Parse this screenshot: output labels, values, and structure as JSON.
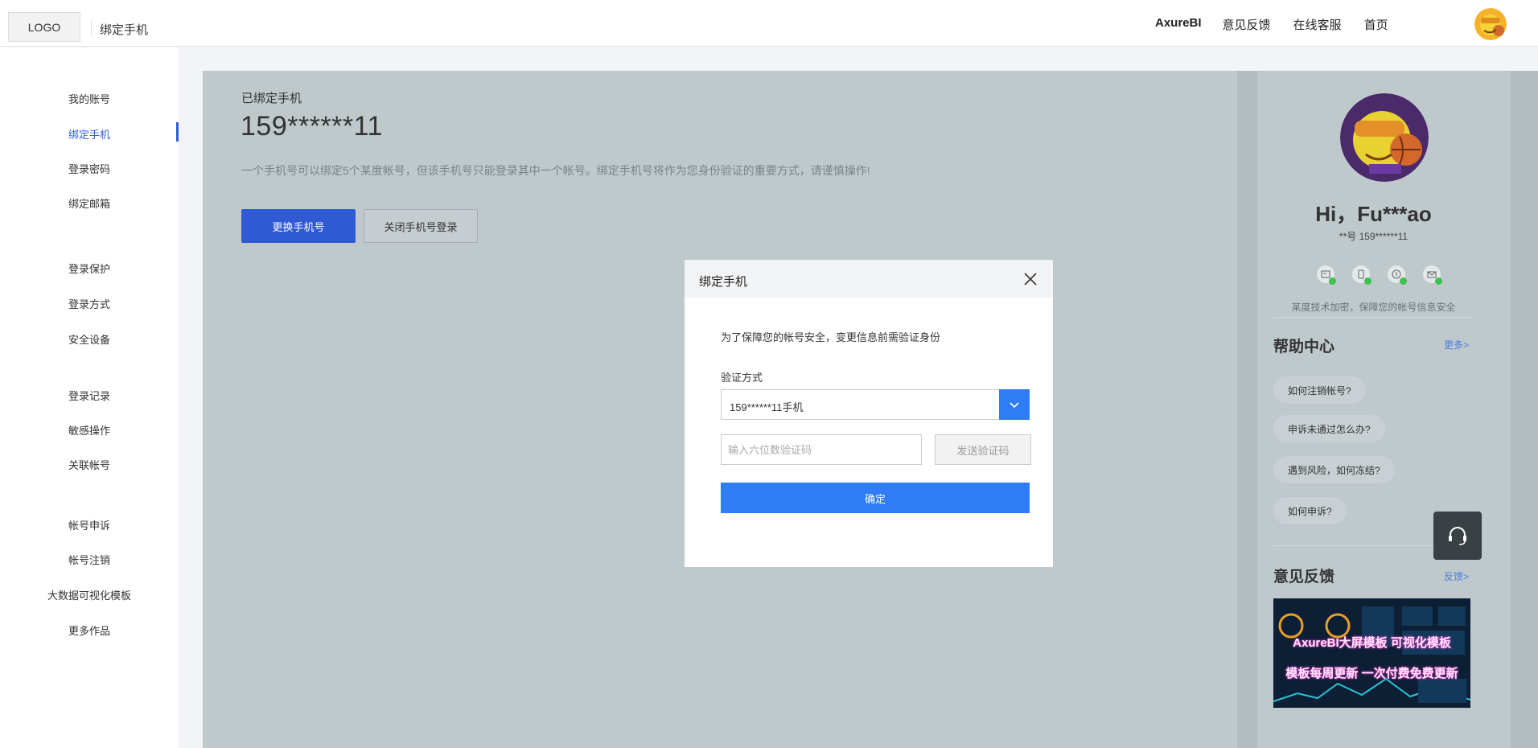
{
  "header": {
    "logo": "LOGO",
    "title": "绑定手机",
    "nav": [
      "AxureBI",
      "意见反馈",
      "在线客服",
      "首页"
    ]
  },
  "sidebar": {
    "items": [
      {
        "label": "我的账号",
        "active": false
      },
      {
        "label": "绑定手机",
        "active": true
      },
      {
        "label": "登录密码",
        "active": false
      },
      {
        "label": "绑定邮箱",
        "active": false
      },
      {
        "label": "登录保护",
        "active": false
      },
      {
        "label": "登录方式",
        "active": false
      },
      {
        "label": "安全设备",
        "active": false
      },
      {
        "label": "登录记录",
        "active": false
      },
      {
        "label": "敏感操作",
        "active": false
      },
      {
        "label": "关联帐号",
        "active": false
      },
      {
        "label": "帐号申诉",
        "active": false
      },
      {
        "label": "帐号注销",
        "active": false
      },
      {
        "label": "大数据可视化模板",
        "active": false
      },
      {
        "label": "更多作品",
        "active": false
      }
    ]
  },
  "main": {
    "bound_label": "已绑定手机",
    "bound_number": "159******11",
    "description": "一个手机号可以绑定5个某度帐号，但该手机号只能登录其中一个帐号。绑定手机号将作为您身份验证的重要方式，请谨慎操作!",
    "change_button": "更换手机号",
    "close_login_button": "关闭手机号登录"
  },
  "profile": {
    "greeting": "Hi，Fu***ao",
    "sub": "**号  159******11",
    "icons": [
      "id-card-icon",
      "phone-icon",
      "shield-icon",
      "mail-icon"
    ],
    "secure_text": "某度技术加密，保障您的帐号信息安全",
    "help_title": "帮助中心",
    "help_more": "更多>",
    "help_items": [
      "如何注销帐号?",
      "申诉未通过怎么办?",
      "遇到风险，如何冻结?",
      "如何申诉?"
    ],
    "feedback_title": "意见反馈",
    "feedback_link": "反馈>",
    "banner_line1": "AxureBI大屏模板 可视化模板",
    "banner_line2": "模板每周更新 一次付费免费更新"
  },
  "modal": {
    "title": "绑定手机",
    "tip": "为了保障您的帐号安全，变更信息前需验证身份",
    "verify_label": "验证方式",
    "verify_value": "159******11手机",
    "code_placeholder": "输入六位数验证码",
    "send_button": "发送验证码",
    "confirm_button": "确定"
  },
  "colors": {
    "primary": "#2f5ad4",
    "modal_primary": "#2e7cf6",
    "overlay": "#bfc8cb",
    "link": "#4a7de0"
  }
}
